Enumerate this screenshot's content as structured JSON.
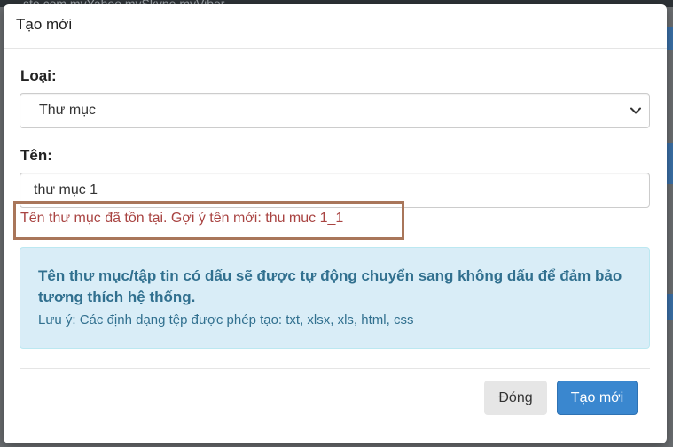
{
  "background": {
    "top_bar_text": "sto.com   myYahoo   mySkype   myViber"
  },
  "modal": {
    "title": "Tạo mới",
    "type_field": {
      "label": "Loại:",
      "selected_value": "Thư mục"
    },
    "name_field": {
      "label": "Tên:",
      "value": "thư mục 1"
    },
    "error_message": "Tên thư mục đã tồn tại. Gợi ý tên mới: thu muc 1_1",
    "info": {
      "main_text": "Tên thư mục/tập tin có dấu sẽ được tự động chuyển sang không dấu để đảm bảo tương thích hệ thống.",
      "note_text": "Lưu ý: Các định dạng tệp được phép tạo: txt, xlsx, xls, html, css"
    },
    "buttons": {
      "close_label": "Đóng",
      "create_label": "Tạo mới"
    }
  },
  "icons": {
    "select_arrow": "chevron-down-icon"
  },
  "colors": {
    "error": "#a94442",
    "info_bg": "#d9edf7",
    "info_text": "#31708f",
    "primary": "#3a87cf",
    "highlight_border": "#a9765a"
  }
}
